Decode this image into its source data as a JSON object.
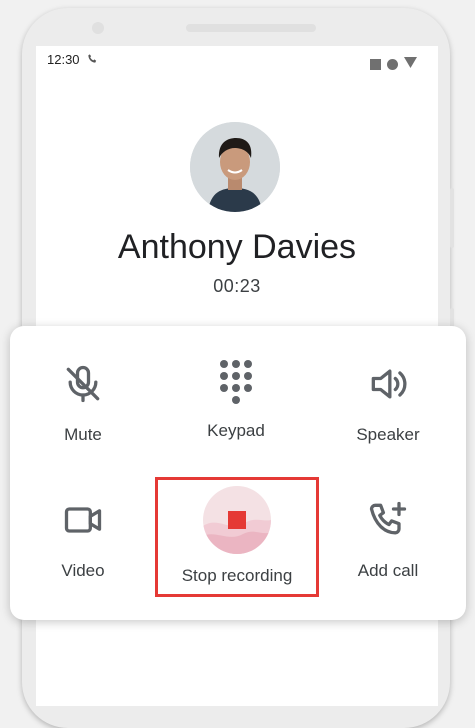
{
  "status_bar": {
    "time": "12:30"
  },
  "call": {
    "contact_name": "Anthony Davies",
    "duration": "00:23"
  },
  "controls": {
    "mute": "Mute",
    "keypad": "Keypad",
    "speaker": "Speaker",
    "video": "Video",
    "stop_recording": "Stop recording",
    "add_call": "Add call"
  },
  "colors": {
    "recording_red": "#e53935",
    "highlight_border": "#e53935",
    "icon_gray": "#5f6368"
  }
}
